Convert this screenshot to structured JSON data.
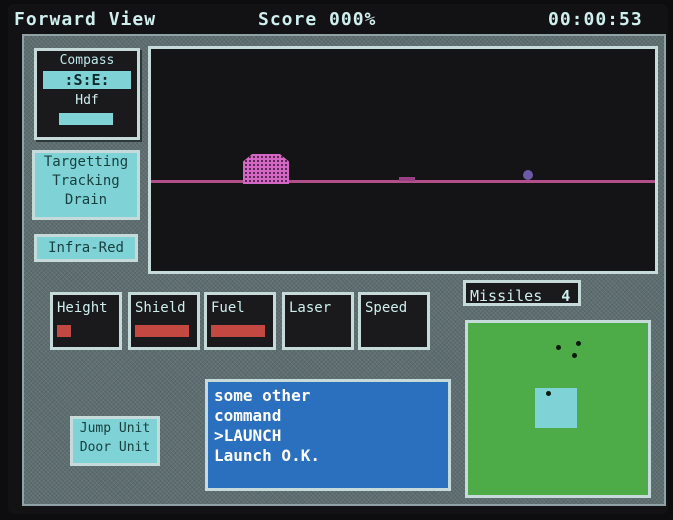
{
  "header": {
    "view_label": "Forward View",
    "score_label": "Score 000%",
    "clock": "00:00:53"
  },
  "compass": {
    "title": "Compass",
    "heading": ":S:E:",
    "subtitle": "Hdf"
  },
  "targeting": {
    "lines": [
      "Targetting",
      "Tracking",
      "Drain"
    ]
  },
  "infrared_button": "Infra-Red",
  "gauges": [
    {
      "label": "Height",
      "level": 0.25
    },
    {
      "label": "Shield",
      "level": 1.0
    },
    {
      "label": "Fuel",
      "level": 1.0
    },
    {
      "label": "Laser",
      "level": 0.0
    },
    {
      "label": "Speed",
      "level": 0.0
    }
  ],
  "units": {
    "jump": "Jump Unit",
    "door": "Door Unit"
  },
  "console": {
    "lines": [
      "some other",
      "command",
      ">LAUNCH",
      "Launch O.K."
    ]
  },
  "missiles": {
    "label": "Missiles",
    "count": "4"
  },
  "colors": {
    "panel": "#5e6e70",
    "cyan": "#7fd2d6",
    "console_bg": "#2b6fbf",
    "radar_bg": "#4eac48",
    "gauge_bar": "#c44842",
    "horizon": "#b04f8a",
    "target": "#d268c3"
  }
}
